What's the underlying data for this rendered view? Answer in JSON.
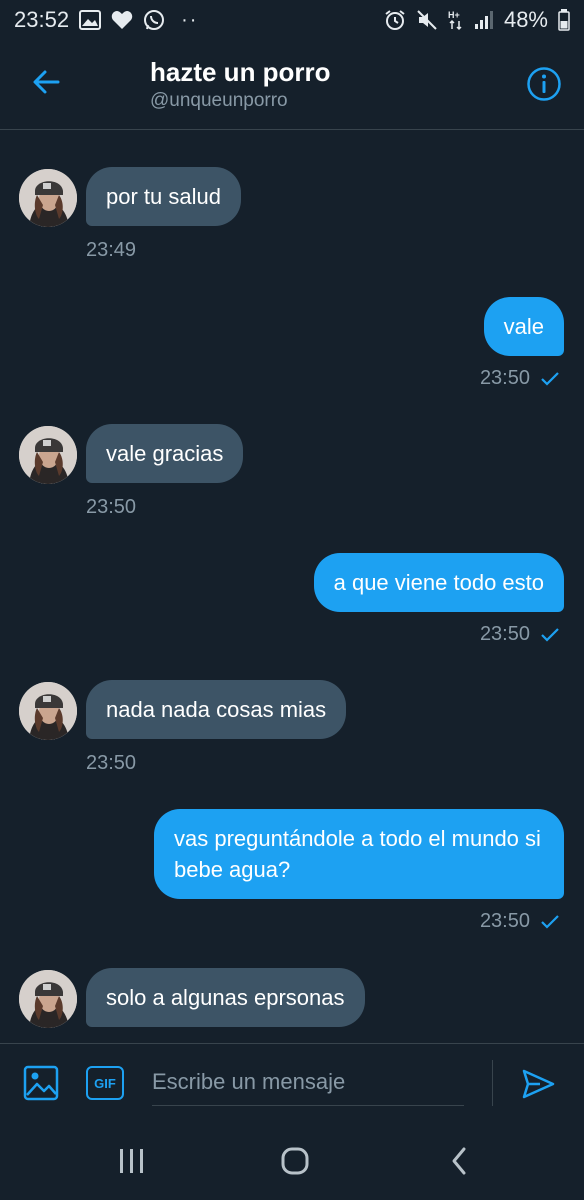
{
  "status_bar": {
    "time": "23:52",
    "left_icons": [
      "image-icon",
      "heart-icon",
      "whatsapp-icon"
    ],
    "dots": "··",
    "right_icons": [
      "alarm-icon",
      "mute-icon",
      "hplus-icon",
      "signal-icon"
    ],
    "battery": "48%"
  },
  "header": {
    "title": "hazte un porro",
    "handle": "@unqueunporro"
  },
  "messages": [
    {
      "direction": "in",
      "text": "por tu salud",
      "time": "23:49"
    },
    {
      "direction": "out",
      "text": "vale",
      "time": "23:50"
    },
    {
      "direction": "in",
      "text": "vale gracias",
      "time": "23:50"
    },
    {
      "direction": "out",
      "text": "a que viene todo esto",
      "time": "23:50"
    },
    {
      "direction": "in",
      "text": "nada nada cosas mias",
      "time": "23:50"
    },
    {
      "direction": "out",
      "text": "vas preguntándole a todo el mundo si bebe agua?",
      "time": "23:50"
    },
    {
      "direction": "in",
      "text": "solo a algunas eprsonas",
      "time": ""
    }
  ],
  "composer": {
    "gif_label": "GIF",
    "placeholder": "Escribe un mensaje"
  },
  "colors": {
    "background": "#15202b",
    "accent": "#1da1f2",
    "incoming_bubble": "#3d5466",
    "secondary_text": "#8899a6"
  }
}
